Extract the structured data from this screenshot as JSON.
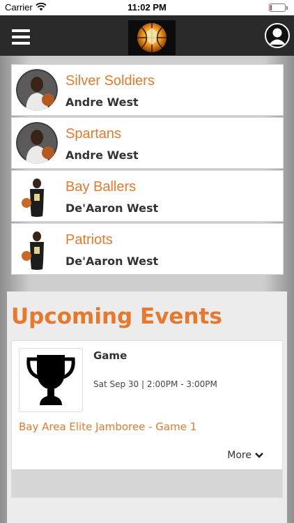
{
  "status_bar": {
    "carrier": "Carrier",
    "time": "11:02 PM",
    "battery_level": 0.1,
    "battery_color": "#e0312b"
  },
  "nav": {
    "menu_icon": "hamburger-menu-icon",
    "logo_icon": "basketball-logo-icon",
    "profile_icon": "user-profile-icon"
  },
  "roster": [
    {
      "team": "Silver Soldiers",
      "player": "Andre West"
    },
    {
      "team": "Spartans",
      "player": "Andre West"
    },
    {
      "team": "Bay Ballers",
      "player": "De'Aaron West"
    },
    {
      "team": "Patriots",
      "player": "De'Aaron West"
    }
  ],
  "events": {
    "heading": "Upcoming Events",
    "items": [
      {
        "icon": "trophy-icon",
        "type": "Game",
        "datetime": "Sat Sep 30 | 2:00PM - 3:00PM",
        "title": "Bay Area Elite Jamboree - Game 1",
        "more_label": "More"
      }
    ]
  },
  "colors": {
    "accent": "#e8782c",
    "navbar": "#2a2a2a"
  }
}
